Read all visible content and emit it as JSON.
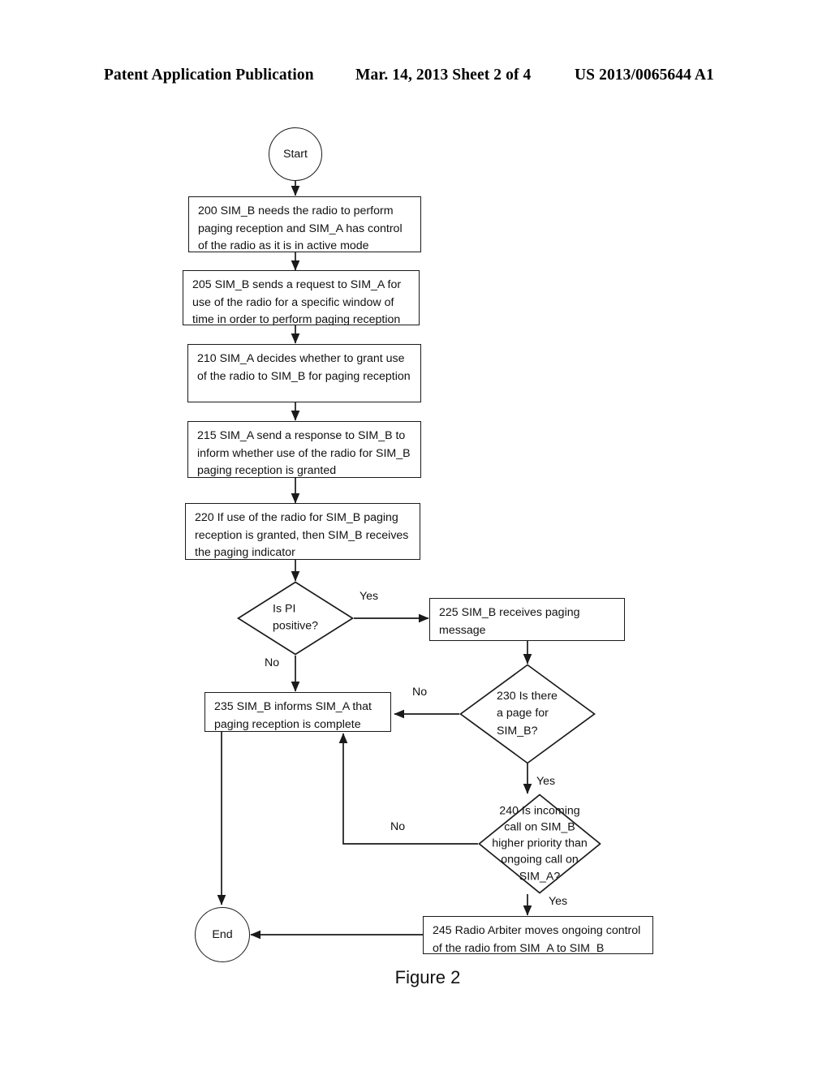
{
  "header": {
    "left": "Patent Application Publication",
    "middle": "Mar. 14, 2013  Sheet 2 of 4",
    "right": "US 2013/0065644 A1"
  },
  "figure": {
    "caption": "Figure 2",
    "nodes": {
      "start": {
        "label": "Start"
      },
      "end": {
        "label": "End"
      },
      "step200": {
        "label": "200 SIM_B needs the radio to perform paging reception and SIM_A has control of the radio as it is in active mode"
      },
      "step205": {
        "label": "205 SIM_B sends a request to SIM_A for use of the radio for a specific window of time in order to perform paging reception"
      },
      "step210": {
        "label": "210 SIM_A decides whether to grant use of the radio to SIM_B for paging reception"
      },
      "step215": {
        "label": "215 SIM_A send a response to SIM_B to inform whether use of the radio for SIM_B paging reception is granted"
      },
      "step220": {
        "label": "220 If use of the radio for SIM_B paging reception is granted, then SIM_B receives the paging indicator"
      },
      "step225": {
        "label": "225 SIM_B receives paging message"
      },
      "step235": {
        "label": "235 SIM_B informs SIM_A that paging reception is complete"
      },
      "step245": {
        "label": "245 Radio Arbiter moves ongoing control of the radio from SIM_A to SIM_B"
      },
      "decisionPI": {
        "line1": "Is PI",
        "line2": "positive?"
      },
      "decision230": {
        "line1": "230 Is there",
        "line2": "a page for",
        "line3": "SIM_B?"
      },
      "decision240": {
        "line1": "240 Is incoming",
        "line2": "call on SIM_B",
        "line3": "higher priority than",
        "line4": "ongoing call on",
        "line5": "SIM_A?"
      }
    },
    "edge_labels": {
      "pi_yes": "Yes",
      "pi_no": "No",
      "d230_no": "No",
      "d230_yes": "Yes",
      "d240_no": "No",
      "d240_yes": "Yes"
    },
    "colors": {
      "stroke": "#1a1a1a",
      "text": "#111111",
      "background": "#ffffff"
    }
  }
}
